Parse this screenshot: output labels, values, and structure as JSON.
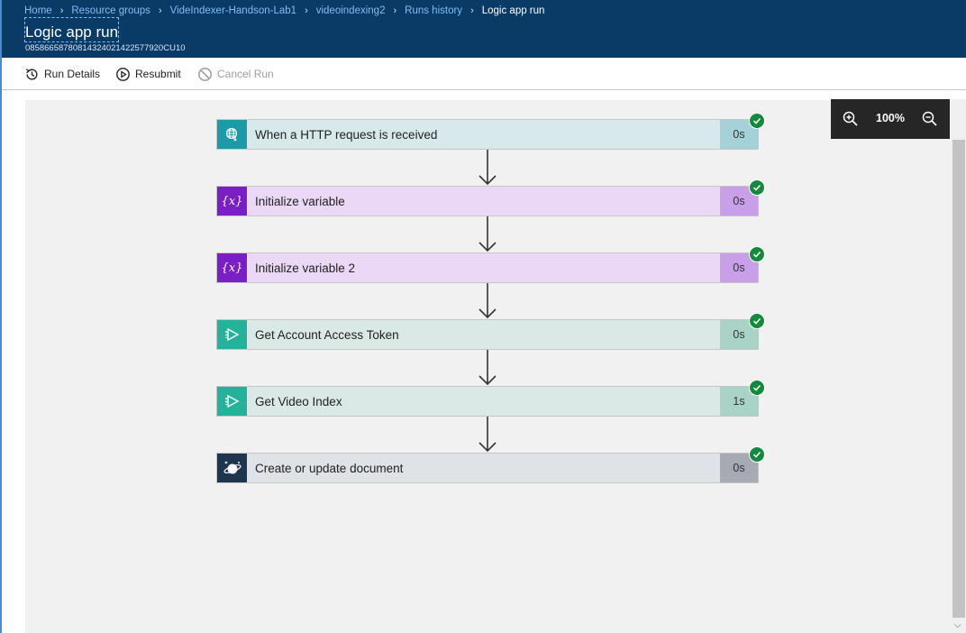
{
  "breadcrumb": [
    {
      "label": "Home"
    },
    {
      "label": "Resource groups"
    },
    {
      "label": "VideIndexer-Handson-Lab1"
    },
    {
      "label": "videoindexing2"
    },
    {
      "label": "Runs history"
    }
  ],
  "breadcrumb_current": "Logic app run",
  "page": {
    "title": "Logic app run",
    "run_id": "08586658780814324021422577920CU10"
  },
  "toolbar": {
    "run_details": "Run Details",
    "resubmit": "Resubmit",
    "cancel_run": "Cancel Run"
  },
  "zoom": {
    "level": "100%"
  },
  "steps": [
    {
      "label": "When a HTTP request is received",
      "duration": "0s",
      "icon": "http-request-icon",
      "status": "succeeded",
      "icon_color": "#1c9aa8",
      "bg": "#d8e9ec",
      "dur_bg": "#a5d2d8"
    },
    {
      "label": "Initialize variable",
      "duration": "0s",
      "icon": "variable-icon",
      "status": "succeeded",
      "icon_color": "#7a1fc6",
      "bg": "#ead8f6",
      "dur_bg": "#c89fe8"
    },
    {
      "label": "Initialize variable 2",
      "duration": "0s",
      "icon": "variable-icon",
      "status": "succeeded",
      "icon_color": "#7a1fc6",
      "bg": "#ead8f6",
      "dur_bg": "#c89fe8"
    },
    {
      "label": "Get Account Access Token",
      "duration": "0s",
      "icon": "video-indexer-icon",
      "status": "succeeded",
      "icon_color": "#25b29a",
      "bg": "#dae9e5",
      "dur_bg": "#a8d3c6"
    },
    {
      "label": "Get Video Index",
      "duration": "1s",
      "icon": "video-indexer-icon",
      "status": "succeeded",
      "icon_color": "#25b29a",
      "bg": "#dae9e5",
      "dur_bg": "#a8d3c6"
    },
    {
      "label": "Create or update document",
      "duration": "0s",
      "icon": "cosmos-db-icon",
      "status": "succeeded",
      "icon_color": "#1e3550",
      "bg": "#dfe2e6",
      "dur_bg": "#a6abb3"
    }
  ]
}
